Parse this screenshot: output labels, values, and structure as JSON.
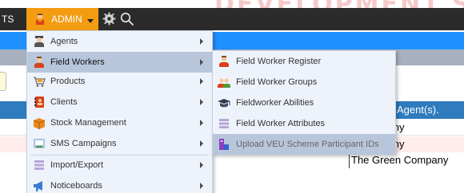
{
  "header": {
    "watermark": "DEVELOPMENT SYSTE",
    "nav_left_label": "TS",
    "admin_label": "ADMIN",
    "accent_color": "#f39c12",
    "bar_color": "#2b2b2b"
  },
  "menu": {
    "items": [
      {
        "label": "Agents",
        "icon": "agent-icon",
        "has_submenu": true
      },
      {
        "label": "Field Workers",
        "icon": "field-worker-icon",
        "has_submenu": true
      },
      {
        "label": "Products",
        "icon": "cart-icon",
        "has_submenu": true
      },
      {
        "label": "Clients",
        "icon": "contact-book-icon",
        "has_submenu": true
      },
      {
        "label": "Stock Management",
        "icon": "box-icon",
        "has_submenu": true
      },
      {
        "label": "SMS Campaigns",
        "icon": "sms-icon",
        "has_submenu": true
      },
      {
        "label": "Import/Export",
        "icon": "import-export-icon",
        "has_submenu": true
      },
      {
        "label": "Noticeboards",
        "icon": "megaphone-icon",
        "has_submenu": true
      }
    ]
  },
  "submenu": {
    "items": [
      {
        "label": "Field Worker Register",
        "icon": "person-icon"
      },
      {
        "label": "Field Worker Groups",
        "icon": "group-icon"
      },
      {
        "label": "Fieldworker Abilities",
        "icon": "graduation-cap-icon"
      },
      {
        "label": "Field Worker Attributes",
        "icon": "list-icon"
      },
      {
        "label": "Upload VEU Scheme Participant IDs",
        "icon": "upload-icon"
      }
    ]
  },
  "table": {
    "column_header": "Agent(s).",
    "rows": [
      "n Company",
      "n Company",
      "The Green Company"
    ]
  }
}
